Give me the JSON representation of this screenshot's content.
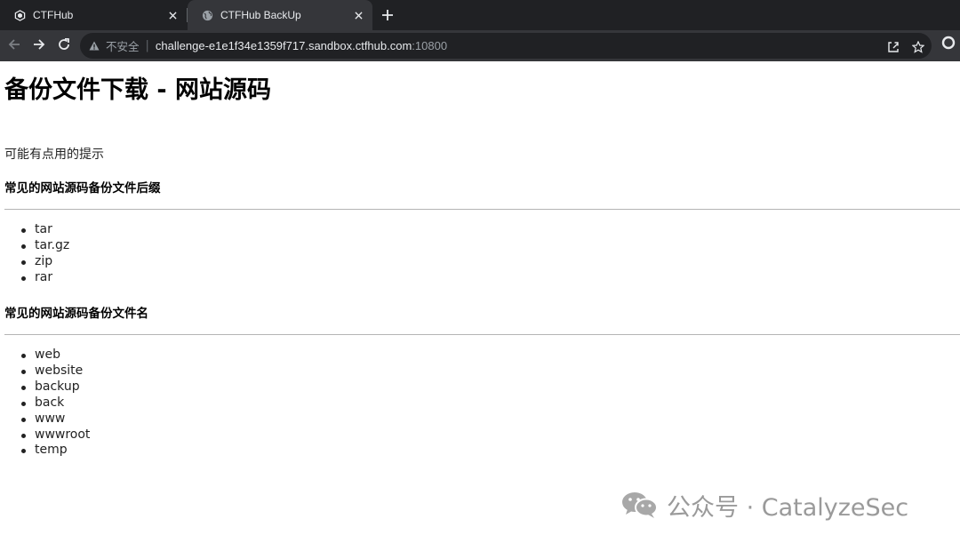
{
  "browser": {
    "tabs": [
      {
        "title": "CTFHub",
        "active": false
      },
      {
        "title": "CTFHub BackUp",
        "active": true
      }
    ],
    "address_bar": {
      "security_label": "不安全",
      "separator": "|",
      "host": "challenge-e1e1f34e1359f717.sandbox.ctfhub.com",
      "port": ":10800"
    }
  },
  "page": {
    "title": "备份文件下载 - 网站源码",
    "hint": "可能有点用的提示",
    "sections": [
      {
        "heading": "常见的网站源码备份文件后缀",
        "items": [
          "tar",
          "tar.gz",
          "zip",
          "rar"
        ]
      },
      {
        "heading": "常见的网站源码备份文件名",
        "items": [
          "web",
          "website",
          "backup",
          "back",
          "www",
          "wwwroot",
          "temp"
        ]
      }
    ]
  },
  "watermark": {
    "text": "公众号 · CatalyzeSec"
  },
  "colors": {
    "tabbar": "#202124",
    "toolbar": "#35363a",
    "omnibox": "#202124",
    "chrome_text": "#e8eaed"
  }
}
